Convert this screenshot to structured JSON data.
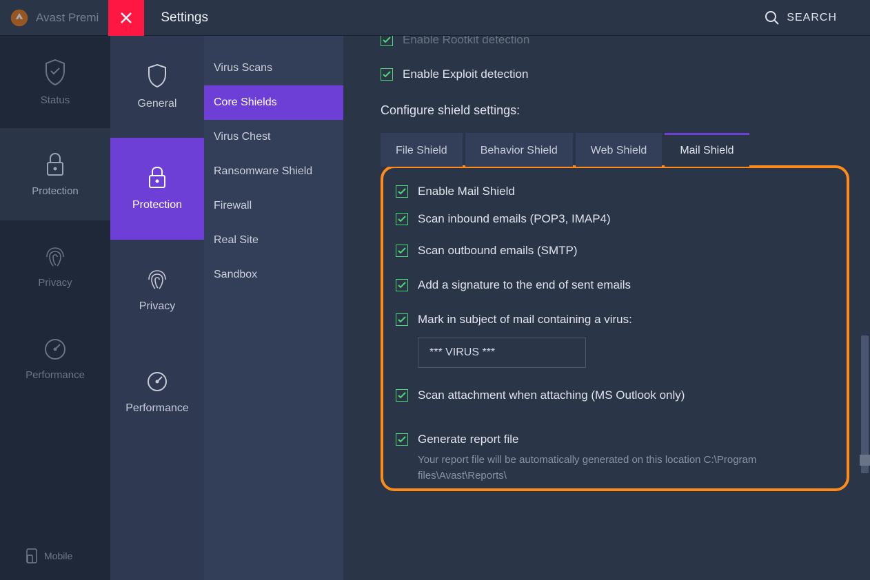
{
  "header": {
    "app_name": "Avast Premi",
    "settings_title": "Settings",
    "search_label": "SEARCH"
  },
  "nav1": {
    "items": [
      {
        "label": "Status"
      },
      {
        "label": "Protection"
      },
      {
        "label": "Privacy"
      },
      {
        "label": "Performance"
      }
    ],
    "mobile_label": "Mobile"
  },
  "nav2": {
    "items": [
      {
        "label": "General"
      },
      {
        "label": "Protection"
      },
      {
        "label": "Privacy"
      },
      {
        "label": "Performance"
      }
    ]
  },
  "nav3": {
    "items": [
      "Virus Scans",
      "Core Shields",
      "Virus Chest",
      "Ransomware Shield",
      "Firewall",
      "Real Site",
      "Sandbox"
    ]
  },
  "content": {
    "rootkit_label": "Enable Rootkit detection",
    "exploit_label": "Enable Exploit detection",
    "configure_heading": "Configure shield settings:",
    "tabs": [
      "File Shield",
      "Behavior Shield",
      "Web Shield",
      "Mail Shield"
    ],
    "mail": {
      "enable": "Enable Mail Shield",
      "inbound": "Scan inbound emails (POP3, IMAP4)",
      "outbound": "Scan outbound emails (SMTP)",
      "signature": "Add a signature to the end of sent emails",
      "mark_subject": "Mark in subject of mail containing a virus:",
      "subject_value": "*** VIRUS ***",
      "scan_attach": "Scan attachment when attaching (MS Outlook only)"
    },
    "report": {
      "label": "Generate report file",
      "desc": "Your report file will be automatically generated on this location C:\\Program files\\Avast\\Reports\\"
    }
  }
}
